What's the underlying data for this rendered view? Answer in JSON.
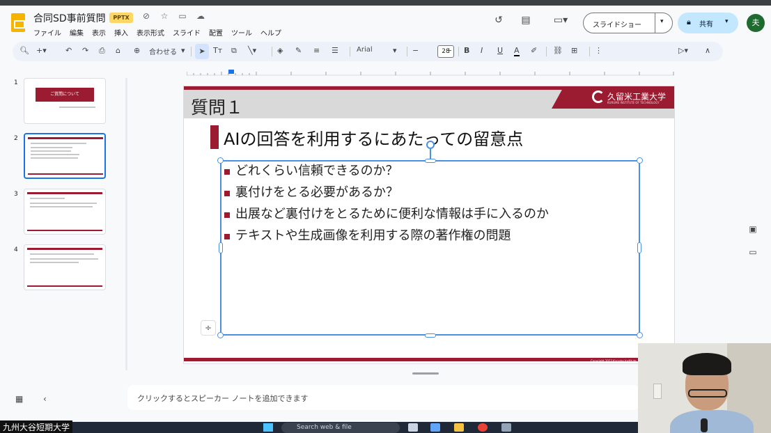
{
  "header": {
    "doc_title": "合同SD事前質問",
    "badge": "PPTX",
    "menu": [
      "ファイル",
      "編集",
      "表示",
      "挿入",
      "表示形式",
      "スライド",
      "配置",
      "ツール",
      "ヘルプ"
    ],
    "slideshow_label": "スライドショー",
    "share_label": "共有",
    "avatar_initial": "夫"
  },
  "toolbar": {
    "zoom_label": "合わせる",
    "font_name": "Arial",
    "font_size": "28"
  },
  "filmstrip": {
    "slides": [
      {
        "number": "1",
        "thumb_title": "ご質問について"
      },
      {
        "number": "2"
      },
      {
        "number": "3"
      },
      {
        "number": "4"
      }
    ],
    "active_index": 1
  },
  "slide": {
    "header_title": "質問１",
    "logo_text": "久留米工業大学",
    "logo_subtext": "KURUME INSTITUTE OF TECHNOLOGY",
    "subtitle": "AIの回答を利用するにあたっての留意点",
    "bullets": [
      "どれくらい信頼できるのか？",
      "裏付けをとる必要があるか？",
      "出展など裏付けをとるために便利な情報は手に入るのか",
      "テキストや生成画像を利用する際の著作権の問題"
    ],
    "copyright": "Copyright 2023 Kurume Institute"
  },
  "notes": {
    "placeholder": "クリックするとスピーカー ノートを追加できます"
  },
  "taskbar": {
    "search_placeholder": "Search web & file"
  },
  "caption": {
    "text": "九州大谷短期大学"
  },
  "colors": {
    "brand": "#9b1b30",
    "selection": "#4a90e2",
    "share_bg": "#c2e7ff"
  }
}
